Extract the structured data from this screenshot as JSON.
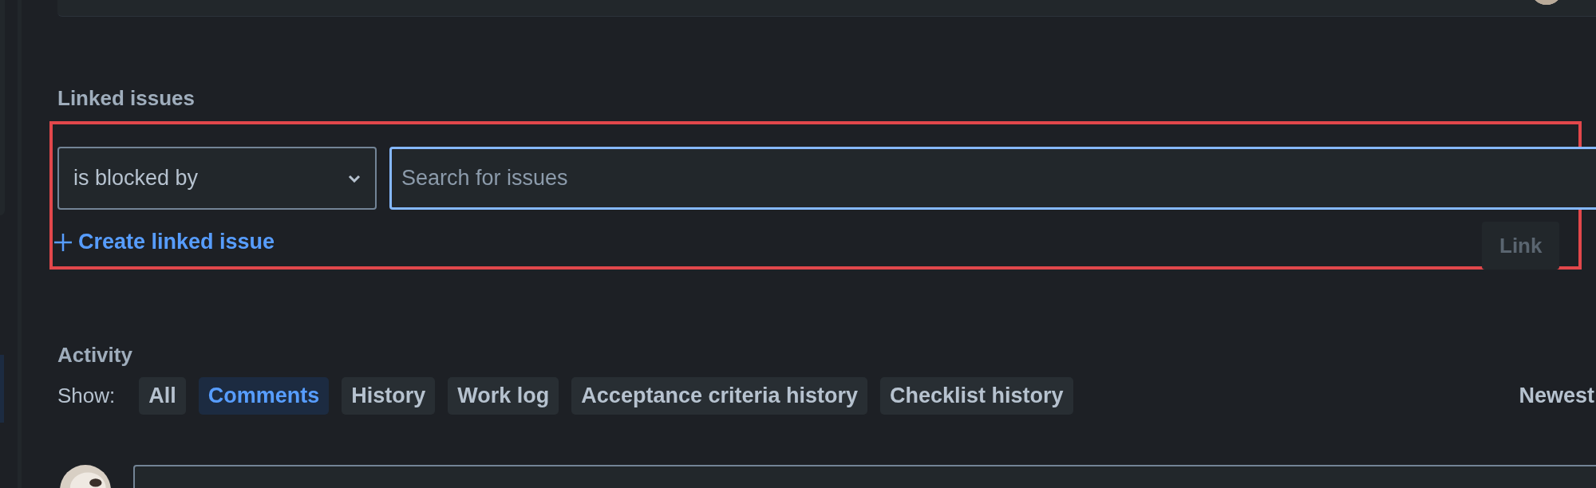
{
  "linked_issues": {
    "title": "Linked issues",
    "link_type": {
      "value": "is blocked by"
    },
    "search": {
      "placeholder": "Search for issues"
    },
    "create_link": "Create linked issue",
    "buttons": [
      {
        "label": "Link",
        "disabled": true
      }
    ]
  },
  "activity": {
    "title": "Activity",
    "show_label": "Show:",
    "filters": [
      {
        "label": "All",
        "selected": false
      },
      {
        "label": "Comments",
        "selected": true
      },
      {
        "label": "History",
        "selected": false
      },
      {
        "label": "Work log",
        "selected": false
      },
      {
        "label": "Acceptance criteria history",
        "selected": false
      },
      {
        "label": "Checklist history",
        "selected": false
      }
    ],
    "sort": "Newest"
  }
}
